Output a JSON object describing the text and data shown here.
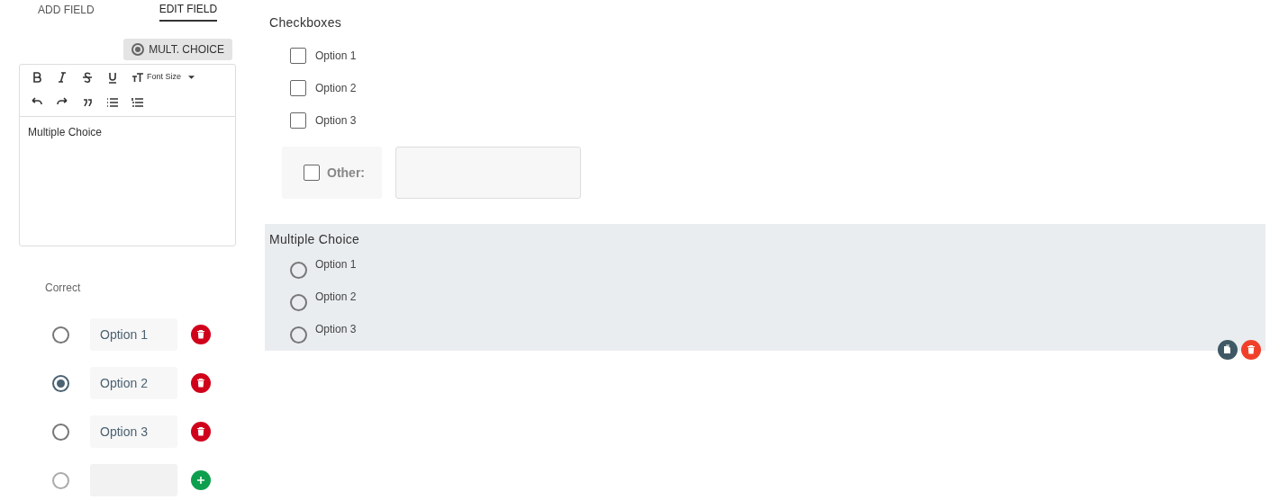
{
  "tabs": [
    {
      "label": "ADD FIELD",
      "selected": false
    },
    {
      "label": "EDIT FIELD",
      "selected": true
    }
  ],
  "field_type": {
    "label": "MULT. CHOICE"
  },
  "editor": {
    "font_size_label": "Font Size",
    "content": "Multiple Choice"
  },
  "correct_label": "Correct",
  "answers": [
    {
      "kind": "option",
      "value": "Option 1",
      "selected": false
    },
    {
      "kind": "option",
      "value": "Option 2",
      "selected": true
    },
    {
      "kind": "option",
      "value": "Option 3",
      "selected": false
    },
    {
      "kind": "new",
      "selected": false
    }
  ],
  "fields": [
    {
      "kind": "checkboxes",
      "title": "Checkboxes",
      "selected": false,
      "options": [
        {
          "label": "Option 1",
          "checked": false
        },
        {
          "label": "Option 2",
          "checked": false
        },
        {
          "label": "Option 3",
          "checked": false
        }
      ],
      "other": {
        "label": "Other:",
        "checked": false
      }
    },
    {
      "kind": "radios",
      "title": "Multiple Choice",
      "selected": true,
      "options": [
        {
          "label": "Option 1",
          "selected": false
        },
        {
          "label": "Option 2",
          "selected": false
        },
        {
          "label": "Option 3",
          "selected": false
        }
      ]
    }
  ]
}
